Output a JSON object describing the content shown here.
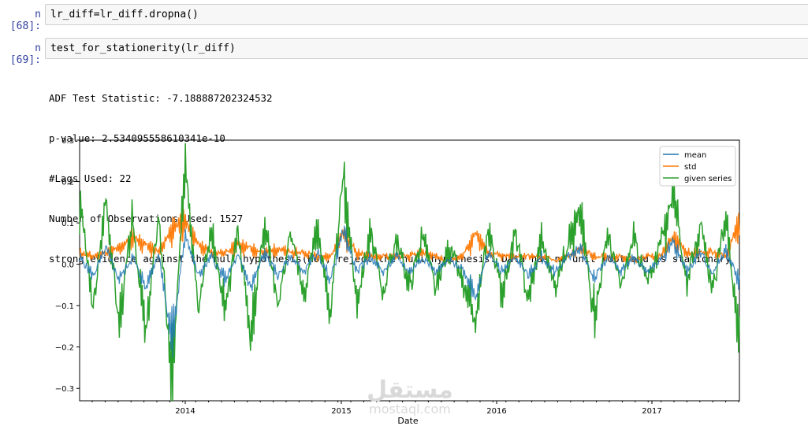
{
  "cells": [
    {
      "prompt": "n [68]:",
      "code": "lr_diff=lr_diff.dropna()"
    },
    {
      "prompt": "n [69]:",
      "code": "test_for_stationerity(lr_diff)"
    }
  ],
  "output_lines": [
    "ADF Test Statistic: -7.188887202324532",
    "p-value: 2.534095558610341e-10",
    "#Lags Used: 22",
    "Number of Observations Used: 1527",
    "strong evidence against the null hypothesis(Ho), reject the null hypothesis. Data has no unit root and is stationary"
  ],
  "watermark": {
    "arabic": "مستقل",
    "latin": "mostaql.com"
  },
  "chart_data": {
    "type": "line",
    "xlabel": "Date",
    "ylabel": "",
    "x_ticks": [
      "2014",
      "2015",
      "2016",
      "2017"
    ],
    "y_ticks": [
      "0.3",
      "0.2",
      "0.1",
      "0.0",
      "−0.1",
      "−0.2",
      "−0.3"
    ],
    "ylim": [
      -0.33,
      0.3
    ],
    "xlim": [
      "2013-05",
      "2017-07"
    ],
    "legend_position": "upper right",
    "grid": false,
    "series": [
      {
        "name": "mean",
        "color": "#1f77b4"
      },
      {
        "name": "std",
        "color": "#ff7f0e"
      },
      {
        "name": "given series",
        "color": "#2ca02c"
      }
    ],
    "approx_points": {
      "x": [
        "2013-05",
        "2013-06",
        "2013-07",
        "2013-08",
        "2013-09",
        "2013-10",
        "2013-11",
        "2013-12",
        "2014-01",
        "2014-02",
        "2014-03",
        "2014-04",
        "2014-05",
        "2014-06",
        "2014-07",
        "2014-08",
        "2014-09",
        "2014-10",
        "2014-11",
        "2014-12",
        "2015-01",
        "2015-02",
        "2015-03",
        "2015-04",
        "2015-05",
        "2015-06",
        "2015-07",
        "2015-08",
        "2015-09",
        "2015-10",
        "2015-11",
        "2015-12",
        "2016-01",
        "2016-02",
        "2016-03",
        "2016-04",
        "2016-05",
        "2016-06",
        "2016-07",
        "2016-08",
        "2016-09",
        "2016-10",
        "2016-11",
        "2016-12",
        "2017-01",
        "2017-02",
        "2017-03",
        "2017-04",
        "2017-05",
        "2017-06",
        "2017-07"
      ],
      "given_series": [
        0.18,
        -0.12,
        0.17,
        -0.16,
        0.12,
        -0.18,
        0.13,
        -0.31,
        0.27,
        -0.1,
        0.09,
        -0.13,
        0.09,
        -0.19,
        0.12,
        -0.1,
        0.08,
        -0.08,
        0.1,
        -0.13,
        0.23,
        -0.1,
        0.08,
        -0.07,
        0.07,
        -0.06,
        0.08,
        -0.07,
        0.05,
        -0.05,
        -0.15,
        0.1,
        -0.08,
        0.08,
        -0.09,
        0.07,
        -0.06,
        0.06,
        0.13,
        -0.14,
        0.08,
        -0.06,
        0.07,
        -0.05,
        0.05,
        0.19,
        -0.05,
        0.1,
        -0.07,
        0.13,
        -0.22
      ],
      "mean": [
        0.02,
        -0.03,
        0.04,
        -0.04,
        0.02,
        -0.06,
        0.03,
        -0.2,
        0.08,
        -0.03,
        0.02,
        -0.04,
        0.02,
        -0.06,
        0.03,
        -0.03,
        0.02,
        -0.02,
        0.03,
        -0.04,
        0.09,
        -0.02,
        0.02,
        -0.02,
        0.02,
        -0.02,
        0.02,
        -0.02,
        0.01,
        -0.01,
        -0.08,
        0.03,
        -0.02,
        0.02,
        -0.03,
        0.02,
        -0.02,
        0.02,
        0.04,
        -0.04,
        0.02,
        -0.02,
        0.02,
        -0.02,
        0.01,
        0.06,
        -0.02,
        0.03,
        -0.02,
        0.04,
        -0.05
      ],
      "std": [
        0.03,
        0.02,
        0.03,
        0.04,
        0.07,
        0.05,
        0.03,
        0.09,
        0.11,
        0.05,
        0.03,
        0.03,
        0.05,
        0.04,
        0.03,
        0.04,
        0.03,
        0.03,
        0.02,
        0.02,
        0.08,
        0.03,
        0.02,
        0.02,
        0.02,
        0.02,
        0.03,
        0.02,
        0.01,
        0.02,
        0.08,
        0.03,
        0.02,
        0.02,
        0.02,
        0.02,
        0.01,
        0.02,
        0.04,
        0.02,
        0.02,
        0.02,
        0.01,
        0.02,
        0.02,
        0.07,
        0.03,
        0.03,
        0.03,
        0.02,
        0.11
      ]
    }
  }
}
